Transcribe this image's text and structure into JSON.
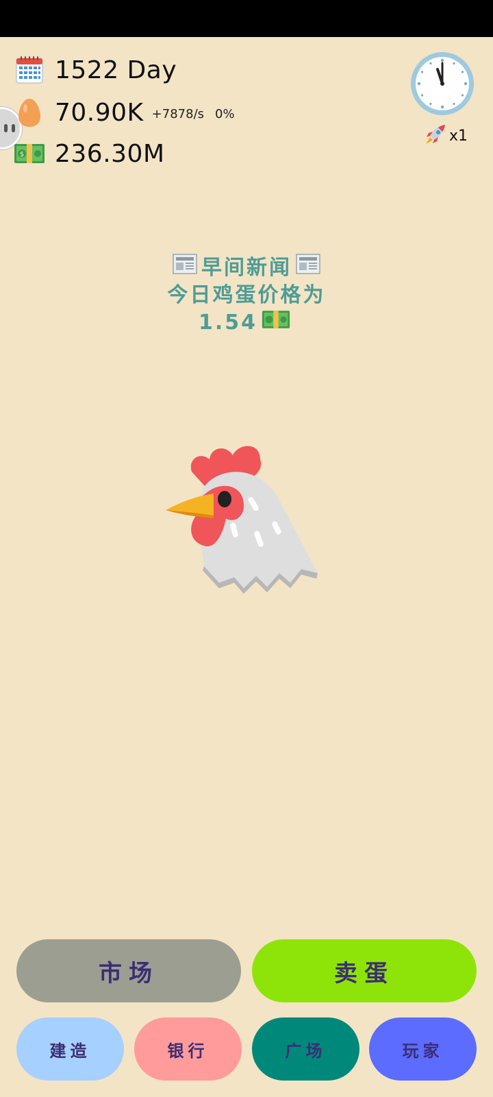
{
  "stats": {
    "day": "1522 Day",
    "eggs": "70.90K",
    "egg_rate": "+7878/s",
    "egg_percent": "0%",
    "money": "236.30M"
  },
  "speed": {
    "label": "x1"
  },
  "news": {
    "title": "早间新闻",
    "line2": "今日鸡蛋价格为",
    "price": "1.54"
  },
  "buttons": {
    "market": "市场",
    "sell_eggs": "卖蛋",
    "build": "建造",
    "bank": "银行",
    "plaza": "广场",
    "player": "玩家"
  },
  "colors": {
    "background": "#f3e4c6",
    "market_button": "#9c9e92",
    "sell_button": "#8ee408",
    "build_button": "#a6d0ff",
    "bank_button": "#ff9b9b",
    "plaza_button": "#00897b",
    "player_button": "#5b6cff",
    "news_text": "#4f9c95"
  },
  "icons": [
    "calendar-icon",
    "egg-icon",
    "money-icon",
    "clock-icon",
    "rocket-icon",
    "newspaper-icon",
    "chicken-icon"
  ]
}
